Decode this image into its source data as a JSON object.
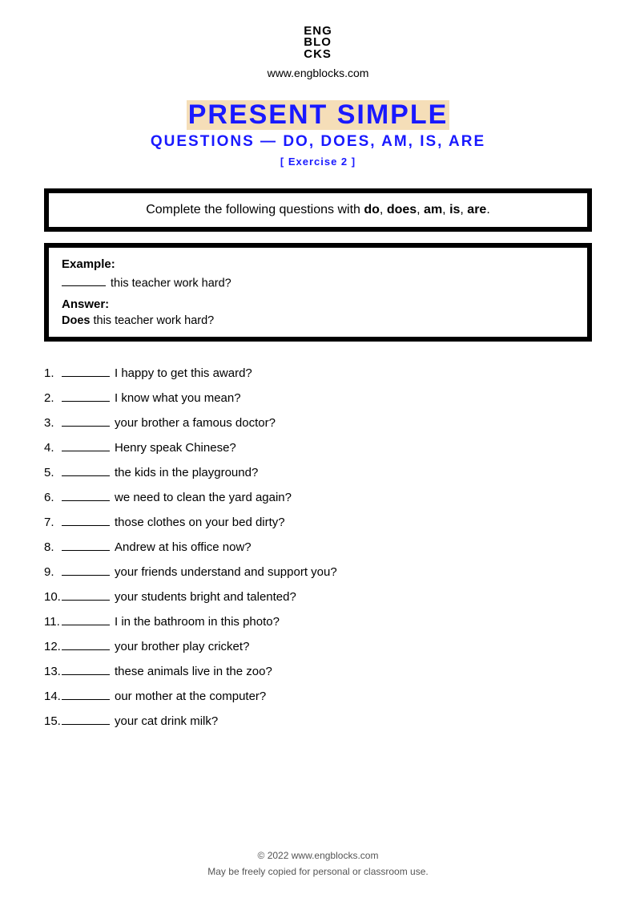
{
  "logo": {
    "l1": "ENG",
    "l2": "BLO",
    "l3": "CKS"
  },
  "website": "www.engblocks.com",
  "heading": {
    "title": "PRESENT SIMPLE",
    "subtitle": "QUESTIONS — DO, DOES, AM, IS, ARE",
    "exercise": "[ Exercise 2 ]"
  },
  "instruction": {
    "prefix": "Complete the following questions with ",
    "words": [
      "do",
      "does",
      "am",
      "is",
      "are"
    ],
    "suffix": "."
  },
  "example": {
    "label_example": "Example:",
    "example_rest": "this teacher work hard?",
    "label_answer": "Answer:",
    "answer_bold": "Does",
    "answer_rest": " this teacher work hard?"
  },
  "questions": [
    {
      "n": "1.",
      "text": "I happy to get this award?"
    },
    {
      "n": "2.",
      "text": "I know what you mean?"
    },
    {
      "n": "3.",
      "text": "your brother a famous doctor?"
    },
    {
      "n": "4.",
      "text": "Henry speak Chinese?"
    },
    {
      "n": "5.",
      "text": "the kids in the playground?"
    },
    {
      "n": "6.",
      "text": "we need to clean the yard again?"
    },
    {
      "n": "7.",
      "text": "those clothes on your bed dirty?"
    },
    {
      "n": "8.",
      "text": "Andrew at his office now?"
    },
    {
      "n": "9.",
      "text": "your friends understand and support you?"
    },
    {
      "n": "10.",
      "text": "your students bright and talented?"
    },
    {
      "n": "11.",
      "text": "I in the bathroom in this photo?"
    },
    {
      "n": "12.",
      "text": "your brother play cricket?"
    },
    {
      "n": "13.",
      "text": "these animals live in the zoo?"
    },
    {
      "n": "14.",
      "text": "our mother at the computer?"
    },
    {
      "n": "15.",
      "text": "your cat drink milk?"
    }
  ],
  "footer": {
    "l1": "© 2022 www.engblocks.com",
    "l2": "May be freely copied for personal or classroom use."
  }
}
